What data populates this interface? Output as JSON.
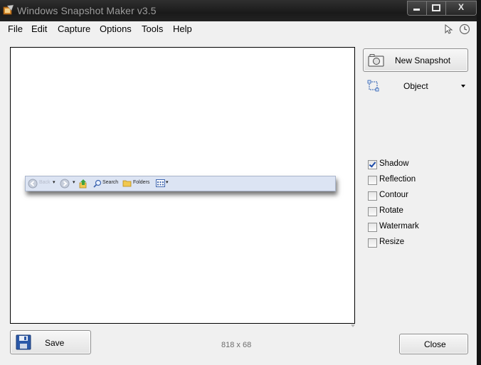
{
  "window": {
    "title": "Windows Snapshot Maker v3.5",
    "controls": {
      "minimize": "‒",
      "maximize": "□",
      "close": "X"
    }
  },
  "menu": {
    "items": [
      "File",
      "Edit",
      "Capture",
      "Options",
      "Tools",
      "Help"
    ]
  },
  "toolbar_right": {
    "icons": [
      "cursor-icon",
      "clock-icon"
    ]
  },
  "preview": {
    "snapshot_toolbar": {
      "back": "Back",
      "search": "Search",
      "folders": "Folders"
    }
  },
  "panel": {
    "new_snapshot_label": "New Snapshot",
    "mode_value": "Object",
    "options": [
      {
        "label": "Shadow",
        "checked": true
      },
      {
        "label": "Reflection",
        "checked": false
      },
      {
        "label": "Contour",
        "checked": false
      },
      {
        "label": "Rotate",
        "checked": false
      },
      {
        "label": "Watermark",
        "checked": false
      },
      {
        "label": "Resize",
        "checked": false
      }
    ]
  },
  "footer": {
    "save_label": "Save",
    "dimensions": "818 x 68",
    "close_label": "Close"
  }
}
